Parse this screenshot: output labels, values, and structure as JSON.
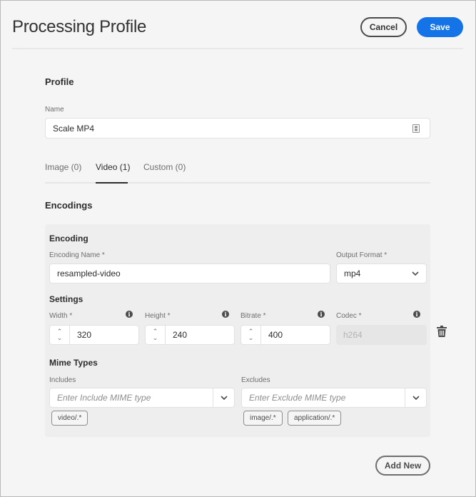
{
  "header": {
    "title": "Processing Profile",
    "cancel_label": "Cancel",
    "save_label": "Save"
  },
  "profile": {
    "section_title": "Profile",
    "name_label": "Name",
    "name_value": "Scale MP4",
    "name_icon": "form-badge-icon"
  },
  "tabs": [
    {
      "label": "Image (0)",
      "active": false
    },
    {
      "label": "Video (1)",
      "active": true
    },
    {
      "label": "Custom (0)",
      "active": false
    }
  ],
  "encodings": {
    "section_title": "Encodings",
    "encoding": {
      "title": "Encoding",
      "name_label": "Encoding Name *",
      "name_value": "resampled-video",
      "format_label": "Output Format *",
      "format_value": "mp4"
    },
    "settings": {
      "title": "Settings",
      "width_label": "Width *",
      "width_value": "320",
      "height_label": "Height *",
      "height_value": "240",
      "bitrate_label": "Bitrate *",
      "bitrate_value": "400",
      "codec_label": "Codec *",
      "codec_value": "h264"
    },
    "mime": {
      "title": "Mime Types",
      "includes_label": "Includes",
      "includes_placeholder": "Enter Include MIME type",
      "includes_tags": [
        "video/.*"
      ],
      "excludes_label": "Excludes",
      "excludes_placeholder": "Enter Exclude MIME type",
      "excludes_tags": [
        "image/.*",
        "application/.*"
      ]
    }
  },
  "add_new_label": "Add New",
  "colors": {
    "accent": "#1473e6",
    "background": "#f5f5f5",
    "card": "#eeeeee"
  }
}
